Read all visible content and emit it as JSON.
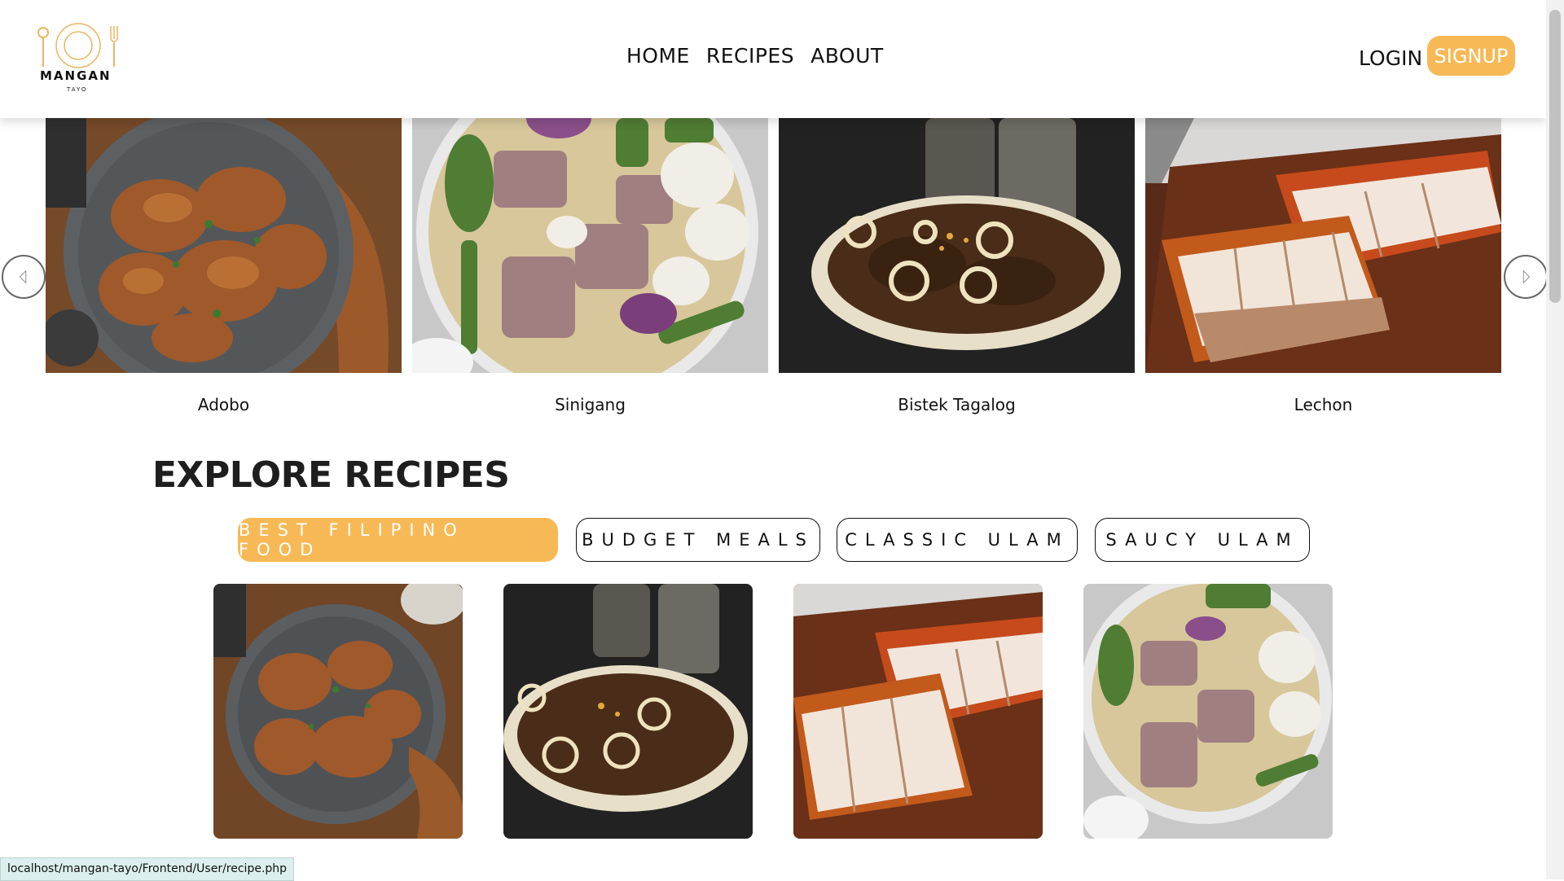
{
  "brand": {
    "name": "MANGAN",
    "sub": "TAYO"
  },
  "nav": {
    "items": [
      "HOME",
      "RECIPES",
      "ABOUT"
    ],
    "login": "LOGIN",
    "signup": "SIGNUP"
  },
  "carousel": {
    "slides": [
      {
        "caption": "Adobo"
      },
      {
        "caption": "Sinigang"
      },
      {
        "caption": "Bistek Tagalog"
      },
      {
        "caption": "Lechon"
      }
    ]
  },
  "explore": {
    "title": "EXPLORE RECIPES",
    "tabs": [
      "BEST FILIPINO FOOD",
      "BUDGET MEALS",
      "CLASSIC ULAM",
      "SAUCY ULAM"
    ],
    "active_tab": 0
  },
  "status_url": "localhost/mangan-tayo/Frontend/User/recipe.php",
  "colors": {
    "accent": "#f7b955"
  }
}
